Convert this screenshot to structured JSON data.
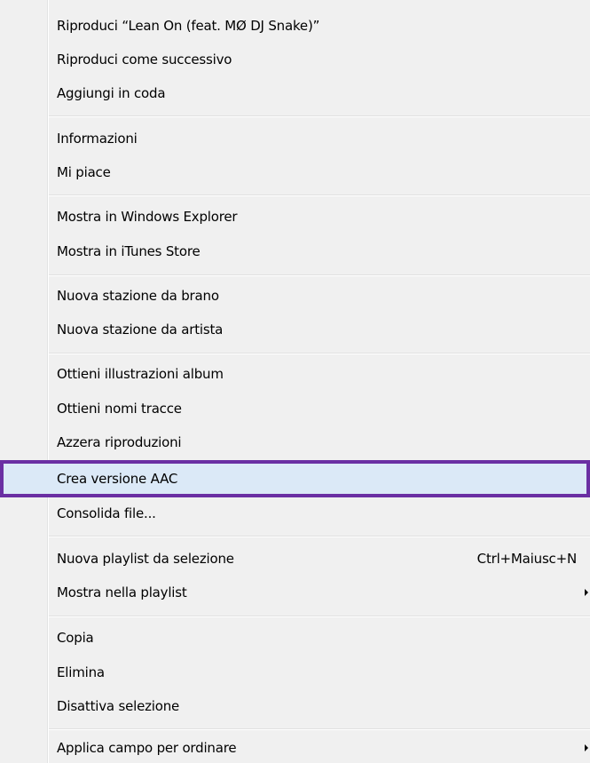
{
  "context_menu": {
    "items": [
      {
        "label": "Riproduci “Lean On (feat. MØ  DJ Snake)”"
      },
      {
        "label": "Riproduci come successivo"
      },
      {
        "label": "Aggiungi in coda"
      },
      {
        "label": "Informazioni"
      },
      {
        "label": "Mi piace"
      },
      {
        "label": "Mostra in Windows Explorer"
      },
      {
        "label": "Mostra in iTunes Store"
      },
      {
        "label": "Nuova stazione da brano"
      },
      {
        "label": "Nuova stazione da artista"
      },
      {
        "label": "Ottieni illustrazioni album"
      },
      {
        "label": "Ottieni nomi tracce"
      },
      {
        "label": "Azzera riproduzioni"
      },
      {
        "label": "Crea versione AAC",
        "highlighted": true
      },
      {
        "label": "Consolida file..."
      },
      {
        "label": "Nuova playlist da selezione",
        "shortcut": "Ctrl+Maiusc+N"
      },
      {
        "label": "Mostra nella playlist",
        "submenu": true
      },
      {
        "label": "Copia"
      },
      {
        "label": "Elimina"
      },
      {
        "label": "Disattiva selezione"
      },
      {
        "label": "Applica campo per ordinare",
        "submenu": true
      }
    ]
  },
  "colors": {
    "menu_background": "#f0f0f0",
    "highlight_background": "#dbe9f7",
    "highlight_border": "#6a2fa3"
  }
}
